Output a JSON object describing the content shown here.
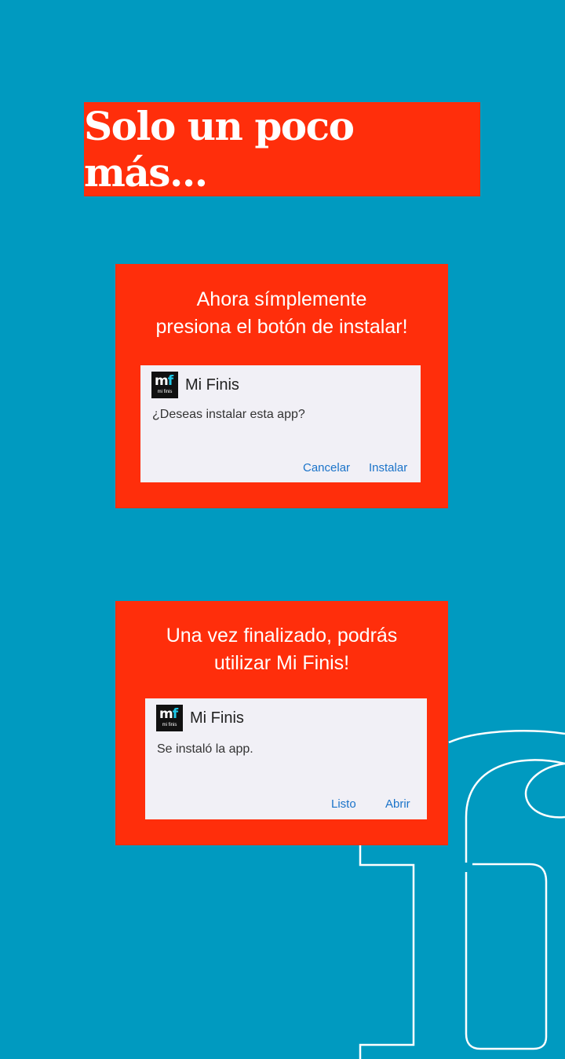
{
  "title": "Solo un poco más...",
  "step1": {
    "caption_line1": "Ahora símplemente",
    "caption_line2": "presiona el botón de instalar!",
    "dialog": {
      "app_name": "Mi Finis",
      "message": "¿Deseas instalar esta app?",
      "button_cancel": "Cancelar",
      "button_install": "Instalar"
    }
  },
  "step2": {
    "caption_line1": "Una vez finalizado, podrás",
    "caption_line2": "utilizar Mi Finis!",
    "dialog": {
      "app_name": "Mi Finis",
      "message": "Se instaló la app.",
      "button_done": "Listo",
      "button_open": "Abrir"
    }
  },
  "app_icon": {
    "letter_m": "m",
    "letter_f": "f",
    "caption": "mi finis"
  },
  "colors": {
    "background": "#009ac0",
    "accent_red": "#ff2e0b",
    "dialog_bg": "#f1f0f6",
    "dialog_button": "#1a73c9"
  },
  "icons": {
    "background_decoration": "outline-letter-f-logo",
    "app": "mi-finis-app-icon"
  }
}
